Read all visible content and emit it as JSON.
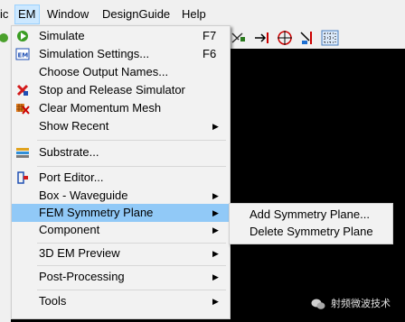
{
  "menubar": {
    "items": [
      "ic",
      "EM",
      "Window",
      "DesignGuide",
      "Help"
    ]
  },
  "menu": {
    "items": [
      {
        "label": "Simulate",
        "shortcut": "F7"
      },
      {
        "label": "Simulation Settings...",
        "shortcut": "F6"
      },
      {
        "label": "Choose Output Names..."
      },
      {
        "label": "Stop and Release Simulator"
      },
      {
        "label": "Clear Momentum Mesh"
      },
      {
        "label": "Show Recent",
        "arrow": "▶"
      },
      {
        "label": "Substrate..."
      },
      {
        "label": "Port Editor..."
      },
      {
        "label": "Box - Waveguide",
        "arrow": "▶"
      },
      {
        "label": "FEM Symmetry Plane",
        "arrow": "▶"
      },
      {
        "label": "Component",
        "arrow": "▶"
      },
      {
        "label": "3D EM Preview",
        "arrow": "▶"
      },
      {
        "label": "Post-Processing",
        "arrow": "▶"
      },
      {
        "label": "Tools",
        "arrow": "▶"
      }
    ],
    "highlighted": "FEM Symmetry Plane"
  },
  "submenu": {
    "items": [
      "Add Symmetry Plane...",
      "Delete Symmetry Plane"
    ]
  },
  "watermark": {
    "text": "射频微波技术"
  },
  "colors": {
    "highlight": "#91c9f7",
    "menu_bg": "#f2f2f2",
    "canvas": "#000000"
  }
}
